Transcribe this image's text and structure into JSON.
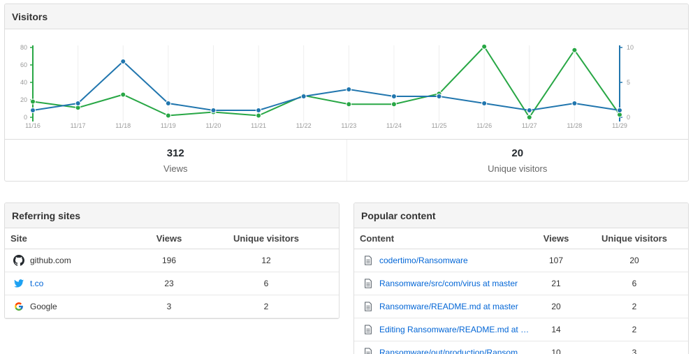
{
  "visitors": {
    "title": "Visitors",
    "stats": [
      {
        "value": "312",
        "label": "Views"
      },
      {
        "value": "20",
        "label": "Unique visitors"
      }
    ]
  },
  "chart_data": {
    "type": "line",
    "categories": [
      "11/16",
      "11/17",
      "11/18",
      "11/19",
      "11/20",
      "11/21",
      "11/22",
      "11/23",
      "11/24",
      "11/25",
      "11/26",
      "11/27",
      "11/28",
      "11/29"
    ],
    "series": [
      {
        "axis": "left",
        "color": "#28a745",
        "values": [
          18,
          11,
          26,
          2,
          6,
          2,
          25,
          15,
          15,
          27,
          81,
          0,
          77,
          3
        ]
      },
      {
        "axis": "right",
        "color": "#2176ae",
        "values": [
          1,
          2,
          8,
          2,
          1,
          1,
          3,
          4,
          3,
          3,
          2,
          1,
          2,
          1
        ]
      }
    ],
    "y_left": {
      "ticks": [
        0,
        20,
        40,
        60,
        80
      ],
      "range": [
        0,
        80
      ]
    },
    "y_right": {
      "ticks": [
        0,
        5,
        10
      ],
      "range": [
        0,
        10
      ]
    },
    "grid": "vertical",
    "legend": "none"
  },
  "referrers": {
    "title": "Referring sites",
    "headers": [
      "Site",
      "Views",
      "Unique visitors"
    ],
    "rows": [
      {
        "icon": "github-icon",
        "name": "github.com",
        "views": "196",
        "uniques": "12",
        "link": false
      },
      {
        "icon": "twitter-icon",
        "name": "t.co",
        "views": "23",
        "uniques": "6",
        "link": true
      },
      {
        "icon": "google-icon",
        "name": "Google",
        "views": "3",
        "uniques": "2",
        "link": false
      }
    ]
  },
  "popular": {
    "title": "Popular content",
    "headers": [
      "Content",
      "Views",
      "Unique visitors"
    ],
    "rows": [
      {
        "icon": "file-icon",
        "name": "codertimo/Ransomware",
        "views": "107",
        "uniques": "20"
      },
      {
        "icon": "file-icon",
        "name": "Ransomware/src/com/virus at master",
        "views": "21",
        "uniques": "6"
      },
      {
        "icon": "file-icon",
        "name": "Ransomware/README.md at master",
        "views": "20",
        "uniques": "2"
      },
      {
        "icon": "file-icon",
        "name": "Editing Ransomware/README.md at …",
        "views": "14",
        "uniques": "2"
      },
      {
        "icon": "file-icon",
        "name": "Ransomware/out/production/Ransomw…",
        "views": "10",
        "uniques": "3"
      }
    ]
  },
  "colors": {
    "green": "#28a745",
    "blue": "#2176ae",
    "link": "#0366d6"
  }
}
